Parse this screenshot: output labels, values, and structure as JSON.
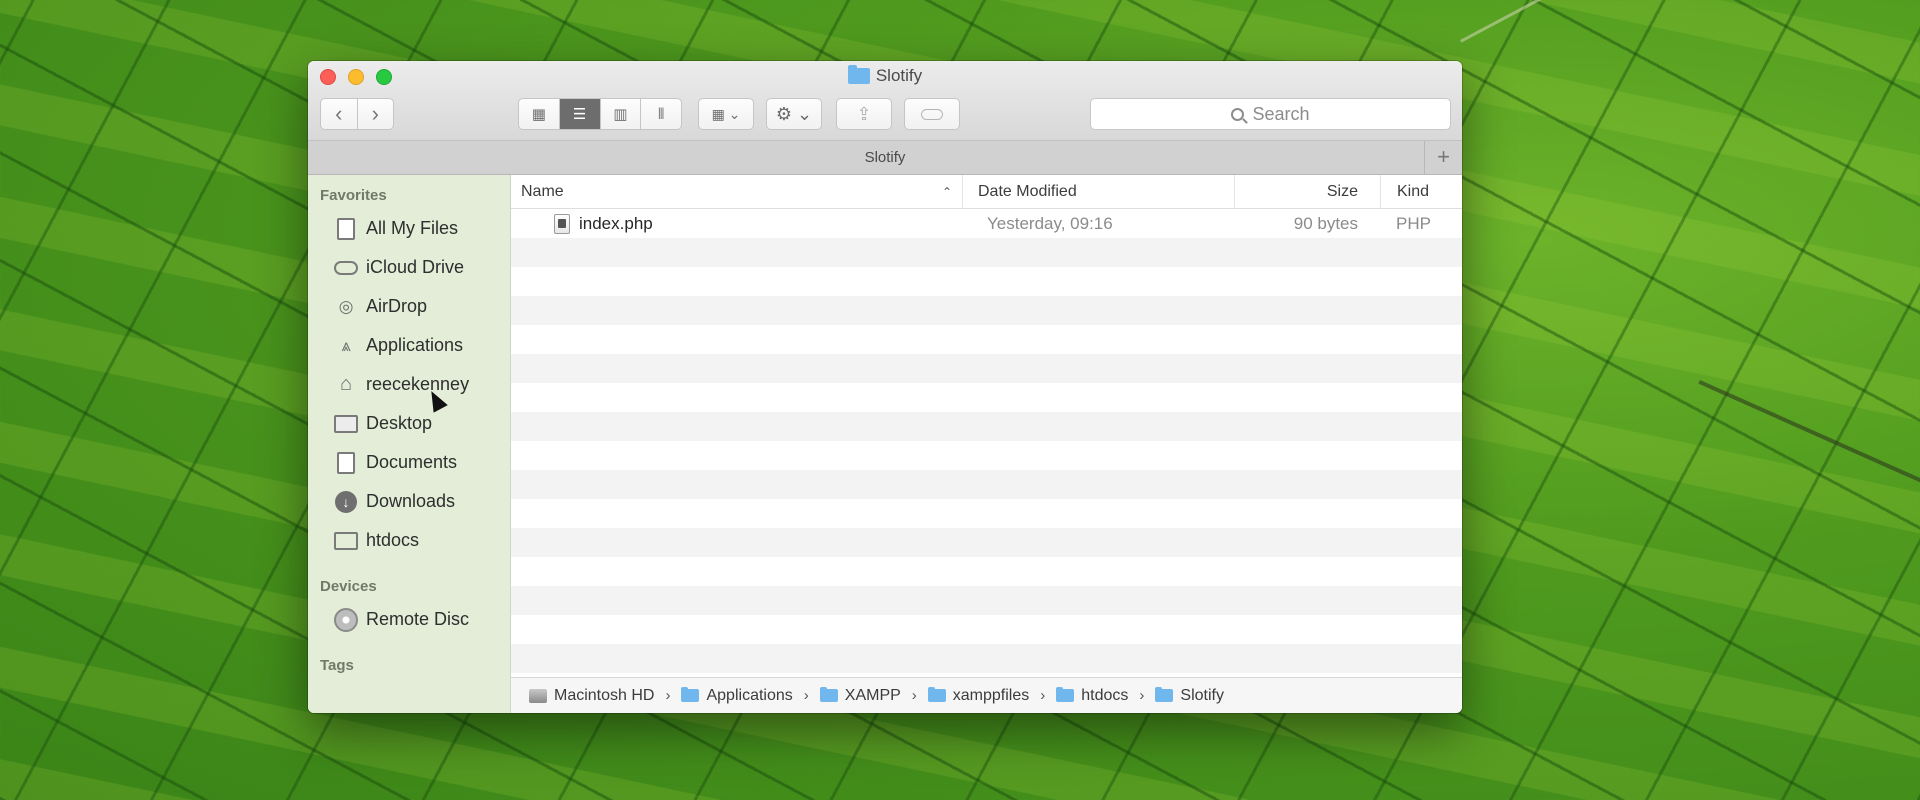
{
  "window": {
    "title": "Slotify",
    "tab_title": "Slotify",
    "new_tab_label": "+"
  },
  "toolbar": {
    "back_label": "‹",
    "forward_label": "›",
    "search_placeholder": "Search",
    "view_mode_selected": "list"
  },
  "sidebar": {
    "favorites_header": "Favorites",
    "favorites": [
      {
        "label": "All My Files",
        "icon": "all-files-icon"
      },
      {
        "label": "iCloud Drive",
        "icon": "cloud-icon"
      },
      {
        "label": "AirDrop",
        "icon": "airdrop-icon"
      },
      {
        "label": "Applications",
        "icon": "applications-icon"
      },
      {
        "label": "reecekenney",
        "icon": "home-icon"
      },
      {
        "label": "Desktop",
        "icon": "desktop-icon"
      },
      {
        "label": "Documents",
        "icon": "documents-icon"
      },
      {
        "label": "Downloads",
        "icon": "downloads-icon"
      },
      {
        "label": "htdocs",
        "icon": "folder-icon"
      }
    ],
    "devices_header": "Devices",
    "devices": [
      {
        "label": "Remote Disc",
        "icon": "disc-icon"
      }
    ],
    "tags_header": "Tags"
  },
  "columns": {
    "name": "Name",
    "date": "Date Modified",
    "size": "Size",
    "kind": "Kind"
  },
  "files": [
    {
      "name": "index.php",
      "date": "Yesterday, 09:16",
      "size": "90 bytes",
      "kind": "PHP"
    }
  ],
  "pathbar": [
    "Macintosh HD",
    "Applications",
    "XAMPP",
    "xamppfiles",
    "htdocs",
    "Slotify"
  ],
  "colors": {
    "sidebar_bg": "#e2ecd6",
    "selected_view_bg": "#6d6d6d",
    "folder_blue": "#6fb7ec"
  }
}
